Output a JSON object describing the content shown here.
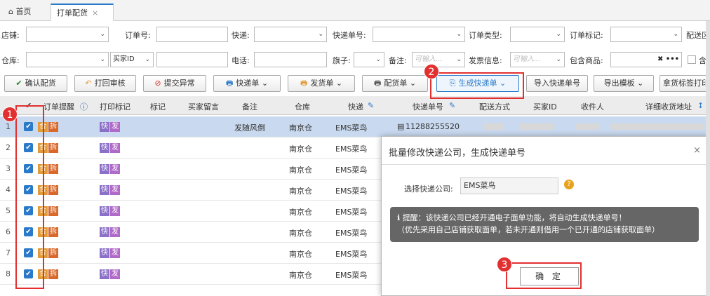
{
  "tabs": {
    "home": "首页",
    "active": "打单配货",
    "close": "×"
  },
  "filters": {
    "row1": [
      {
        "label": "店铺:"
      },
      {
        "label": "订单号:"
      },
      {
        "label": "快递:"
      },
      {
        "label": "快递单号:"
      },
      {
        "label": "订单类型:"
      },
      {
        "label": "订单标记:"
      },
      {
        "label": "配送区"
      }
    ],
    "row2": {
      "warehouse": "仓库:",
      "buyer_select": "买家ID",
      "phone": "电话:",
      "flag": "旗子:",
      "remark": "备注:",
      "remark_ph": "可输入...",
      "invoice": "发票信息:",
      "invoice_ph": "可输入...",
      "goods": "包含商品:",
      "clear": "✖ •••",
      "contain": "含"
    }
  },
  "toolbar": [
    {
      "label": "确认配货",
      "icon": "✔"
    },
    {
      "label": "打回审核",
      "icon": "↶"
    },
    {
      "label": "提交异常",
      "icon": "⊘"
    },
    {
      "label": "快递单",
      "icon": "🖶",
      "arrow": "⌄"
    },
    {
      "label": "发货单",
      "icon": "🖶",
      "arrow": "⌄"
    },
    {
      "label": "配货单",
      "icon": "🖶",
      "arrow": "⌄"
    },
    {
      "label": "生成快递单",
      "icon": "⎘",
      "arrow": "⌄"
    },
    {
      "label": "导入快递单号"
    },
    {
      "label": "导出模板",
      "arrow": "⌄"
    },
    {
      "label": "拿货标签打印"
    }
  ],
  "table": {
    "headers": [
      "✔",
      "订单提醒",
      "打印标记",
      "标记",
      "买家留言",
      "备注",
      "仓库",
      "快递",
      "快递单号",
      "配送方式",
      "买家ID",
      "收件人",
      "详细收货地址"
    ],
    "rows": [
      {
        "n": "1",
        "remark": "发随风倒",
        "warehouse": "南京仓",
        "express": "EMS菜鸟",
        "tracking": "11288255520"
      },
      {
        "n": "2",
        "remark": "",
        "warehouse": "南京仓",
        "express": "EMS菜鸟",
        "tracking": ""
      },
      {
        "n": "3",
        "remark": "",
        "warehouse": "南京仓",
        "express": "EMS菜鸟",
        "tracking": ""
      },
      {
        "n": "4",
        "remark": "",
        "warehouse": "南京仓",
        "express": "EMS菜鸟",
        "tracking": ""
      },
      {
        "n": "5",
        "remark": "",
        "warehouse": "南京仓",
        "express": "EMS菜鸟",
        "tracking": ""
      },
      {
        "n": "6",
        "remark": "",
        "warehouse": "南京仓",
        "express": "EMS菜鸟",
        "tracking": ""
      },
      {
        "n": "7",
        "remark": "",
        "warehouse": "南京仓",
        "express": "EMS菜鸟",
        "tracking": ""
      },
      {
        "n": "8",
        "remark": "",
        "warehouse": "南京仓",
        "express": "EMS菜鸟",
        "tracking": ""
      }
    ],
    "tags": {
      "he": "合",
      "chai": "拆",
      "kuai": "快",
      "fa": "发"
    }
  },
  "dialog": {
    "title": "批量修改快递公司，生成快递单号",
    "close": "×",
    "label": "选择快递公司:",
    "value": "EMS菜鸟",
    "notice1": "提醒：该快递公司已经开通电子面单功能，将自动生成快递单号！",
    "notice2": "（优先采用自己店铺获取面单，若未开通则借用一个已开通的店铺获取面单）",
    "ok": "确 定"
  },
  "badges": [
    "1",
    "2",
    "3"
  ]
}
